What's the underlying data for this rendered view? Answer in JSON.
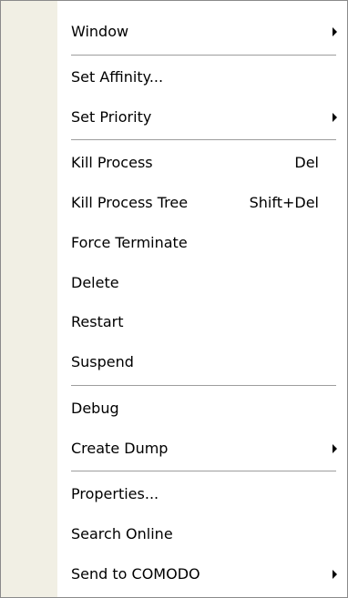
{
  "menu": {
    "window": "Window",
    "set_affinity": "Set Affinity...",
    "set_priority": "Set Priority",
    "kill_process": "Kill Process",
    "kill_process_shortcut": "Del",
    "kill_process_tree": "Kill Process Tree",
    "kill_process_tree_shortcut": "Shift+Del",
    "force_terminate": "Force Terminate",
    "delete": "Delete",
    "restart": "Restart",
    "suspend": "Suspend",
    "debug": "Debug",
    "create_dump": "Create Dump",
    "properties": "Properties...",
    "search_online": "Search Online",
    "send_to_comodo": "Send to COMODO"
  },
  "icons": {
    "submenu_arrow": "submenu-arrow-icon"
  },
  "colors": {
    "gutter": "#f1efe4",
    "border": "#8a8a8a",
    "separator": "#9d9d9d"
  }
}
